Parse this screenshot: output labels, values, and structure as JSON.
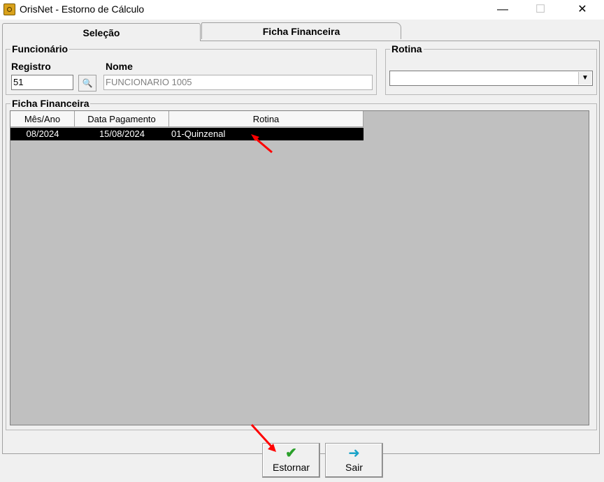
{
  "window": {
    "title": "OrisNet - Estorno de Cálculo"
  },
  "tabs": [
    {
      "label": "Seleção"
    },
    {
      "label": "Ficha Financeira"
    }
  ],
  "funcionario": {
    "group_label": "Funcionário",
    "registro_label": "Registro",
    "registro_value": "51",
    "nome_label": "Nome",
    "nome_value": "FUNCIONARIO 1005"
  },
  "rotina": {
    "group_label": "Rotina",
    "value": ""
  },
  "ficha": {
    "group_label": "Ficha Financeira",
    "columns": [
      "Mês/Ano",
      "Data Pagamento",
      "Rotina"
    ],
    "rows": [
      {
        "mes_ano": "08/2024",
        "data_pagamento": "15/08/2024",
        "rotina": "01-Quinzenal"
      }
    ]
  },
  "buttons": {
    "estornar": "Estornar",
    "sair": "Sair"
  },
  "icons": {
    "app": "app-icon",
    "lookup": "search-people-icon",
    "estornar": "check-icon",
    "sair": "arrow-right-icon"
  },
  "colors": {
    "selected_row_bg": "#000000",
    "grid_bg": "#c0c0c0",
    "annotation_arrow": "#ff0000"
  }
}
